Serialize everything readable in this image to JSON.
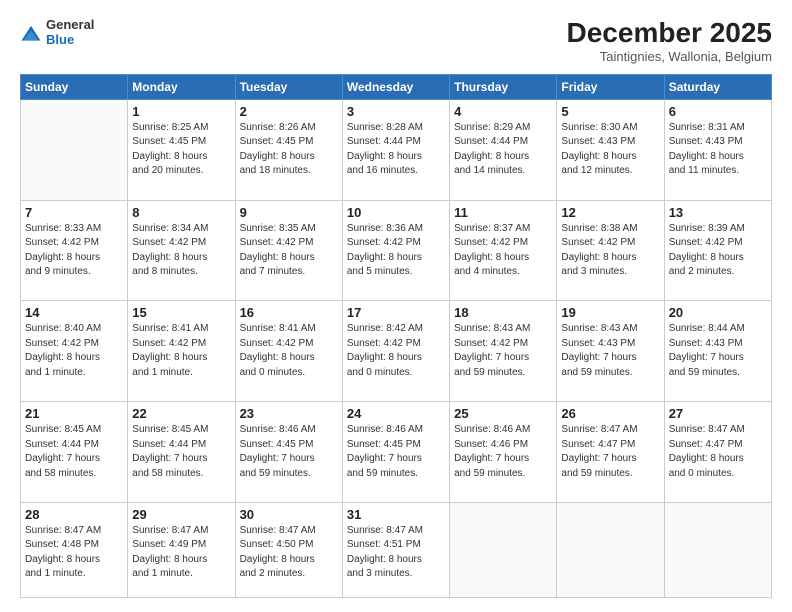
{
  "logo": {
    "general": "General",
    "blue": "Blue"
  },
  "header": {
    "month": "December 2025",
    "location": "Taintignies, Wallonia, Belgium"
  },
  "weekdays": [
    "Sunday",
    "Monday",
    "Tuesday",
    "Wednesday",
    "Thursday",
    "Friday",
    "Saturday"
  ],
  "weeks": [
    [
      {
        "day": "",
        "info": ""
      },
      {
        "day": "1",
        "info": "Sunrise: 8:25 AM\nSunset: 4:45 PM\nDaylight: 8 hours\nand 20 minutes."
      },
      {
        "day": "2",
        "info": "Sunrise: 8:26 AM\nSunset: 4:45 PM\nDaylight: 8 hours\nand 18 minutes."
      },
      {
        "day": "3",
        "info": "Sunrise: 8:28 AM\nSunset: 4:44 PM\nDaylight: 8 hours\nand 16 minutes."
      },
      {
        "day": "4",
        "info": "Sunrise: 8:29 AM\nSunset: 4:44 PM\nDaylight: 8 hours\nand 14 minutes."
      },
      {
        "day": "5",
        "info": "Sunrise: 8:30 AM\nSunset: 4:43 PM\nDaylight: 8 hours\nand 12 minutes."
      },
      {
        "day": "6",
        "info": "Sunrise: 8:31 AM\nSunset: 4:43 PM\nDaylight: 8 hours\nand 11 minutes."
      }
    ],
    [
      {
        "day": "7",
        "info": "Sunrise: 8:33 AM\nSunset: 4:42 PM\nDaylight: 8 hours\nand 9 minutes."
      },
      {
        "day": "8",
        "info": "Sunrise: 8:34 AM\nSunset: 4:42 PM\nDaylight: 8 hours\nand 8 minutes."
      },
      {
        "day": "9",
        "info": "Sunrise: 8:35 AM\nSunset: 4:42 PM\nDaylight: 8 hours\nand 7 minutes."
      },
      {
        "day": "10",
        "info": "Sunrise: 8:36 AM\nSunset: 4:42 PM\nDaylight: 8 hours\nand 5 minutes."
      },
      {
        "day": "11",
        "info": "Sunrise: 8:37 AM\nSunset: 4:42 PM\nDaylight: 8 hours\nand 4 minutes."
      },
      {
        "day": "12",
        "info": "Sunrise: 8:38 AM\nSunset: 4:42 PM\nDaylight: 8 hours\nand 3 minutes."
      },
      {
        "day": "13",
        "info": "Sunrise: 8:39 AM\nSunset: 4:42 PM\nDaylight: 8 hours\nand 2 minutes."
      }
    ],
    [
      {
        "day": "14",
        "info": "Sunrise: 8:40 AM\nSunset: 4:42 PM\nDaylight: 8 hours\nand 1 minute."
      },
      {
        "day": "15",
        "info": "Sunrise: 8:41 AM\nSunset: 4:42 PM\nDaylight: 8 hours\nand 1 minute."
      },
      {
        "day": "16",
        "info": "Sunrise: 8:41 AM\nSunset: 4:42 PM\nDaylight: 8 hours\nand 0 minutes."
      },
      {
        "day": "17",
        "info": "Sunrise: 8:42 AM\nSunset: 4:42 PM\nDaylight: 8 hours\nand 0 minutes."
      },
      {
        "day": "18",
        "info": "Sunrise: 8:43 AM\nSunset: 4:42 PM\nDaylight: 7 hours\nand 59 minutes."
      },
      {
        "day": "19",
        "info": "Sunrise: 8:43 AM\nSunset: 4:43 PM\nDaylight: 7 hours\nand 59 minutes."
      },
      {
        "day": "20",
        "info": "Sunrise: 8:44 AM\nSunset: 4:43 PM\nDaylight: 7 hours\nand 59 minutes."
      }
    ],
    [
      {
        "day": "21",
        "info": "Sunrise: 8:45 AM\nSunset: 4:44 PM\nDaylight: 7 hours\nand 58 minutes."
      },
      {
        "day": "22",
        "info": "Sunrise: 8:45 AM\nSunset: 4:44 PM\nDaylight: 7 hours\nand 58 minutes."
      },
      {
        "day": "23",
        "info": "Sunrise: 8:46 AM\nSunset: 4:45 PM\nDaylight: 7 hours\nand 59 minutes."
      },
      {
        "day": "24",
        "info": "Sunrise: 8:46 AM\nSunset: 4:45 PM\nDaylight: 7 hours\nand 59 minutes."
      },
      {
        "day": "25",
        "info": "Sunrise: 8:46 AM\nSunset: 4:46 PM\nDaylight: 7 hours\nand 59 minutes."
      },
      {
        "day": "26",
        "info": "Sunrise: 8:47 AM\nSunset: 4:47 PM\nDaylight: 7 hours\nand 59 minutes."
      },
      {
        "day": "27",
        "info": "Sunrise: 8:47 AM\nSunset: 4:47 PM\nDaylight: 8 hours\nand 0 minutes."
      }
    ],
    [
      {
        "day": "28",
        "info": "Sunrise: 8:47 AM\nSunset: 4:48 PM\nDaylight: 8 hours\nand 1 minute."
      },
      {
        "day": "29",
        "info": "Sunrise: 8:47 AM\nSunset: 4:49 PM\nDaylight: 8 hours\nand 1 minute."
      },
      {
        "day": "30",
        "info": "Sunrise: 8:47 AM\nSunset: 4:50 PM\nDaylight: 8 hours\nand 2 minutes."
      },
      {
        "day": "31",
        "info": "Sunrise: 8:47 AM\nSunset: 4:51 PM\nDaylight: 8 hours\nand 3 minutes."
      },
      {
        "day": "",
        "info": ""
      },
      {
        "day": "",
        "info": ""
      },
      {
        "day": "",
        "info": ""
      }
    ]
  ]
}
